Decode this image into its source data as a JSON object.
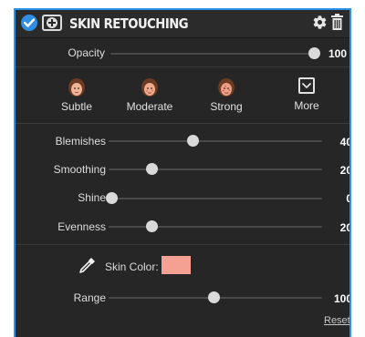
{
  "header": {
    "title": "SKIN RETOUCHING",
    "enabled": true
  },
  "opacity": {
    "label": "Opacity",
    "value": "100",
    "level": 1.0
  },
  "presets": [
    {
      "label": "Subtle",
      "icon": "face-subtle-icon"
    },
    {
      "label": "Moderate",
      "icon": "face-moderate-icon"
    },
    {
      "label": "Strong",
      "icon": "face-strong-icon"
    },
    {
      "label": "More",
      "icon": "chevron-down-box-icon"
    }
  ],
  "sliders": [
    {
      "label": "Blemishes",
      "value": "40",
      "level": 0.4
    },
    {
      "label": "Smoothing",
      "value": "20",
      "level": 0.2
    },
    {
      "label": "Shine",
      "value": "0",
      "level": 0.0
    },
    {
      "label": "Evenness",
      "value": "20",
      "level": 0.2
    }
  ],
  "skin_color": {
    "label": "Skin Color:",
    "color": "#f4a093"
  },
  "range": {
    "label": "Range",
    "value": "100",
    "level": 0.5
  },
  "reset_label": "Reset",
  "colors": {
    "accent": "#2a93e8",
    "panel": "#262626"
  }
}
